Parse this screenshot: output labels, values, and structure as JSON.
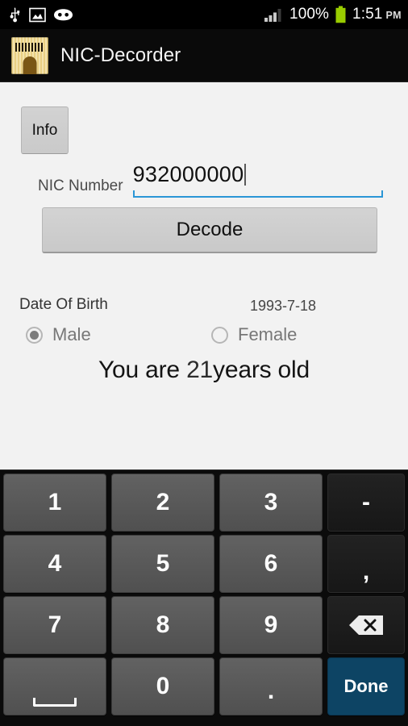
{
  "status_bar": {
    "left_icons": [
      "usb-icon",
      "screenshot-image-icon",
      "cyanogenmod-head-icon"
    ],
    "signal_icon": "signal-bars-icon",
    "battery_percent": "100%",
    "battery_icon": "battery-full-icon",
    "battery_color": "#99cc00",
    "time": "1:51",
    "ampm": "PM"
  },
  "action_bar": {
    "app_icon": "app-launcher-icon",
    "title": "NIC-Decorder"
  },
  "form": {
    "info_button": "Info",
    "nic_label": "NIC Number",
    "nic_value": "932000000",
    "nic_placeholder": "NIC Number",
    "nic_underline_color": "#2a96d6",
    "decode_button": "Decode"
  },
  "result": {
    "dob_label": "Date Of Birth",
    "dob_value": "1993-7-18",
    "gender_options": [
      {
        "label": "Male",
        "selected": true
      },
      {
        "label": "Female",
        "selected": false
      }
    ],
    "age_prefix": "You are ",
    "age_value": "21",
    "age_suffix": "years old"
  },
  "keyboard": {
    "rows": [
      [
        {
          "label": "1",
          "type": "num",
          "name": "key-1"
        },
        {
          "label": "2",
          "type": "num",
          "name": "key-2"
        },
        {
          "label": "3",
          "type": "num",
          "name": "key-3"
        },
        {
          "label": "-",
          "type": "fn",
          "name": "key-minus"
        }
      ],
      [
        {
          "label": "4",
          "type": "num",
          "name": "key-4"
        },
        {
          "label": "5",
          "type": "num",
          "name": "key-5"
        },
        {
          "label": "6",
          "type": "num",
          "name": "key-6"
        },
        {
          "label": ",",
          "type": "fn",
          "name": "key-comma"
        }
      ],
      [
        {
          "label": "7",
          "type": "num",
          "name": "key-7"
        },
        {
          "label": "8",
          "type": "num",
          "name": "key-8"
        },
        {
          "label": "9",
          "type": "num",
          "name": "key-9"
        },
        {
          "label": "",
          "type": "fn",
          "name": "key-backspace",
          "icon": "backspace-icon"
        }
      ],
      [
        {
          "label": "",
          "type": "num",
          "name": "key-space",
          "icon": "space-bar-icon"
        },
        {
          "label": "0",
          "type": "num",
          "name": "key-0"
        },
        {
          "label": ".",
          "type": "num",
          "name": "key-period"
        },
        {
          "label": "Done",
          "type": "done",
          "name": "key-done"
        }
      ]
    ],
    "done_color": "#0d4464"
  }
}
